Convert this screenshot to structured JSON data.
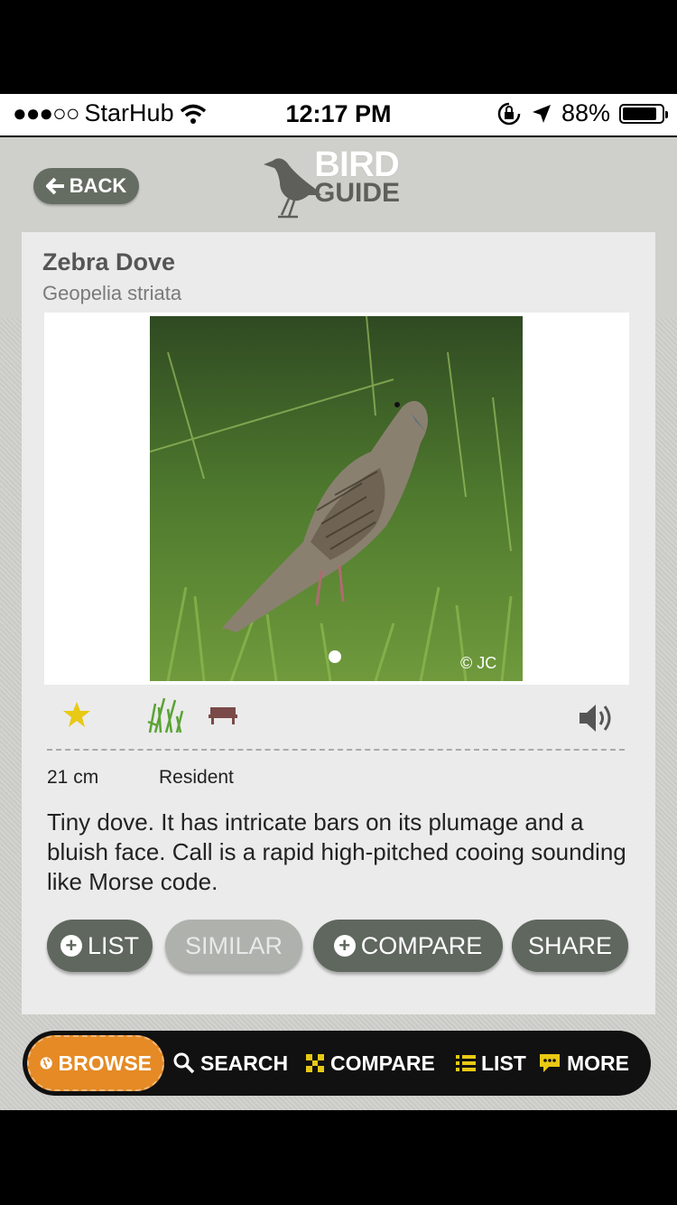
{
  "status_bar": {
    "signal": "●●●○○",
    "carrier": "StarHub",
    "time": "12:17 PM",
    "battery": "88%",
    "battery_level": 0.88
  },
  "header": {
    "back_label": "BACK",
    "logo_line1": "BIRD",
    "logo_line2": "GUIDE"
  },
  "bird": {
    "common_name": "Zebra Dove",
    "scientific_name": "Geopelia striata",
    "photo_credit": "© JC",
    "size": "21 cm",
    "status": "Resident",
    "description": "Tiny dove. It has intricate bars on its plumage and a bluish face. Call is a rapid high-pitched cooing sounding like Morse code."
  },
  "attribute_icons": [
    "star-icon",
    "grass-habitat-icon",
    "bench-park-icon",
    "speaker-sound-icon"
  ],
  "actions": {
    "list": "LIST",
    "similar": "SIMILAR",
    "compare": "COMPARE",
    "share": "SHARE"
  },
  "tabbar": {
    "browse": "BROWSE",
    "search": "SEARCH",
    "compare": "COMPARE",
    "list": "LIST",
    "more": "MORE"
  },
  "colors": {
    "accent": "#e58a25",
    "button": "#5f675e",
    "star": "#e8c915"
  }
}
